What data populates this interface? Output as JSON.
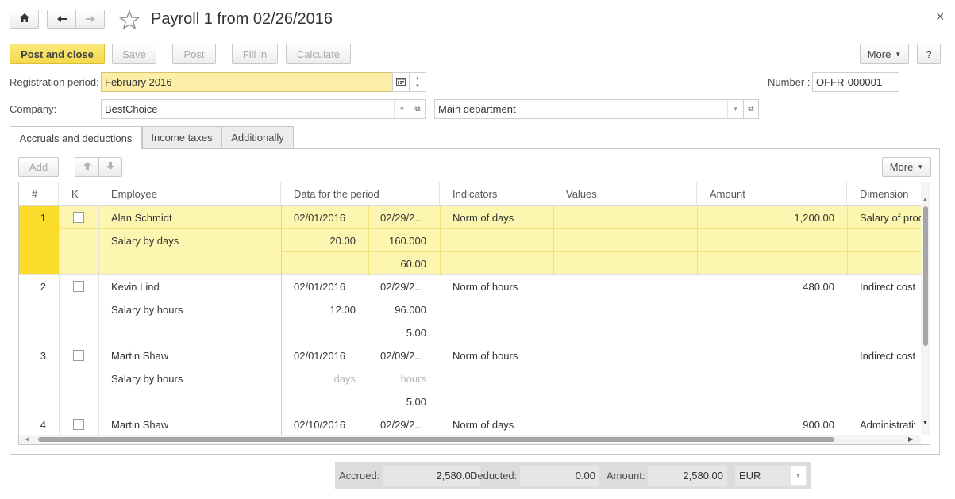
{
  "window": {
    "title": "Payroll 1 from 02/26/2016",
    "close_glyph": "×",
    "home_glyph": "⌂",
    "back_glyph": "←",
    "forward_glyph": "→",
    "star_glyph": "☆"
  },
  "toolbar": {
    "post_and_close": "Post and close",
    "save": "Save",
    "post": "Post",
    "fill_in": "Fill in",
    "calculate": "Calculate",
    "more": "More",
    "help": "?"
  },
  "form": {
    "registration_period_label": "Registration period:",
    "registration_period_value": "February 2016",
    "number_label": "Number :",
    "number_value": "OFFR-000001",
    "company_label": "Company:",
    "company_value": "BestChoice",
    "department_value": "Main department"
  },
  "tabs": [
    {
      "label": "Accruals and deductions",
      "active": true
    },
    {
      "label": "Income taxes",
      "active": false
    },
    {
      "label": "Additionally",
      "active": false
    }
  ],
  "table_toolbar": {
    "add": "Add",
    "more": "More"
  },
  "table": {
    "headers": {
      "num": "#",
      "k": "K",
      "employee": "Employee",
      "data_for_period": "Data for the period",
      "indicators": "Indicators",
      "values": "Values",
      "amount": "Amount",
      "dimension": "Dimension"
    },
    "rows": [
      {
        "num": "1",
        "selected": true,
        "checked": false,
        "employee": "Alan Schmidt",
        "accrual": "Salary by days",
        "date_from": "02/01/2016",
        "date_to": "02/29/2...",
        "val_a": "20.00",
        "val_b": "160.000",
        "val_c": "60.00",
        "indicator": "Norm of days",
        "values": "",
        "amount": "1,200.00",
        "dimension": "Salary of prod"
      },
      {
        "num": "2",
        "selected": false,
        "checked": false,
        "employee": "Kevin Lind",
        "accrual": "Salary by hours",
        "date_from": "02/01/2016",
        "date_to": "02/29/2...",
        "val_a": "12.00",
        "val_b": "96.000",
        "val_c": "5.00",
        "indicator": "Norm of hours",
        "values": "",
        "amount": "480.00",
        "dimension": "Indirect cost"
      },
      {
        "num": "3",
        "selected": false,
        "checked": false,
        "employee": "Martin Shaw",
        "accrual": "Salary by hours",
        "date_from": "02/01/2016",
        "date_to": "02/09/2...",
        "val_a": "days",
        "val_b": "hours",
        "val_c": "5.00",
        "indicator": "Norm of hours",
        "values": "",
        "amount": "",
        "dimension": "Indirect cost"
      },
      {
        "num": "4",
        "selected": false,
        "checked": false,
        "employee": "Martin Shaw",
        "accrual": "",
        "date_from": "02/10/2016",
        "date_to": "02/29/2...",
        "val_a": "",
        "val_b": "",
        "val_c": "",
        "indicator": "Norm of days",
        "values": "",
        "amount": "900.00",
        "dimension": "Administrativ"
      }
    ]
  },
  "totals": {
    "accrued_label": "Accrued:",
    "accrued_value": "2,580.00",
    "deducted_label": "Deducted:",
    "deducted_value": "0.00",
    "amount_label": "Amount:",
    "amount_value": "2,580.00",
    "currency": "EUR"
  },
  "colors": {
    "accent_yellow": "#f4d94a",
    "selected_row": "#fdf6b0",
    "selected_num": "#fcdc2a"
  },
  "icons": {
    "home": "home-icon",
    "back": "arrow-left-icon",
    "forward": "arrow-right-icon",
    "favorite": "star-icon",
    "close": "close-icon",
    "calendar": "calendar-icon",
    "dropdown": "chevron-down-icon",
    "open": "open-window-icon",
    "move_up": "arrow-up-icon",
    "move_down": "arrow-down-icon"
  }
}
